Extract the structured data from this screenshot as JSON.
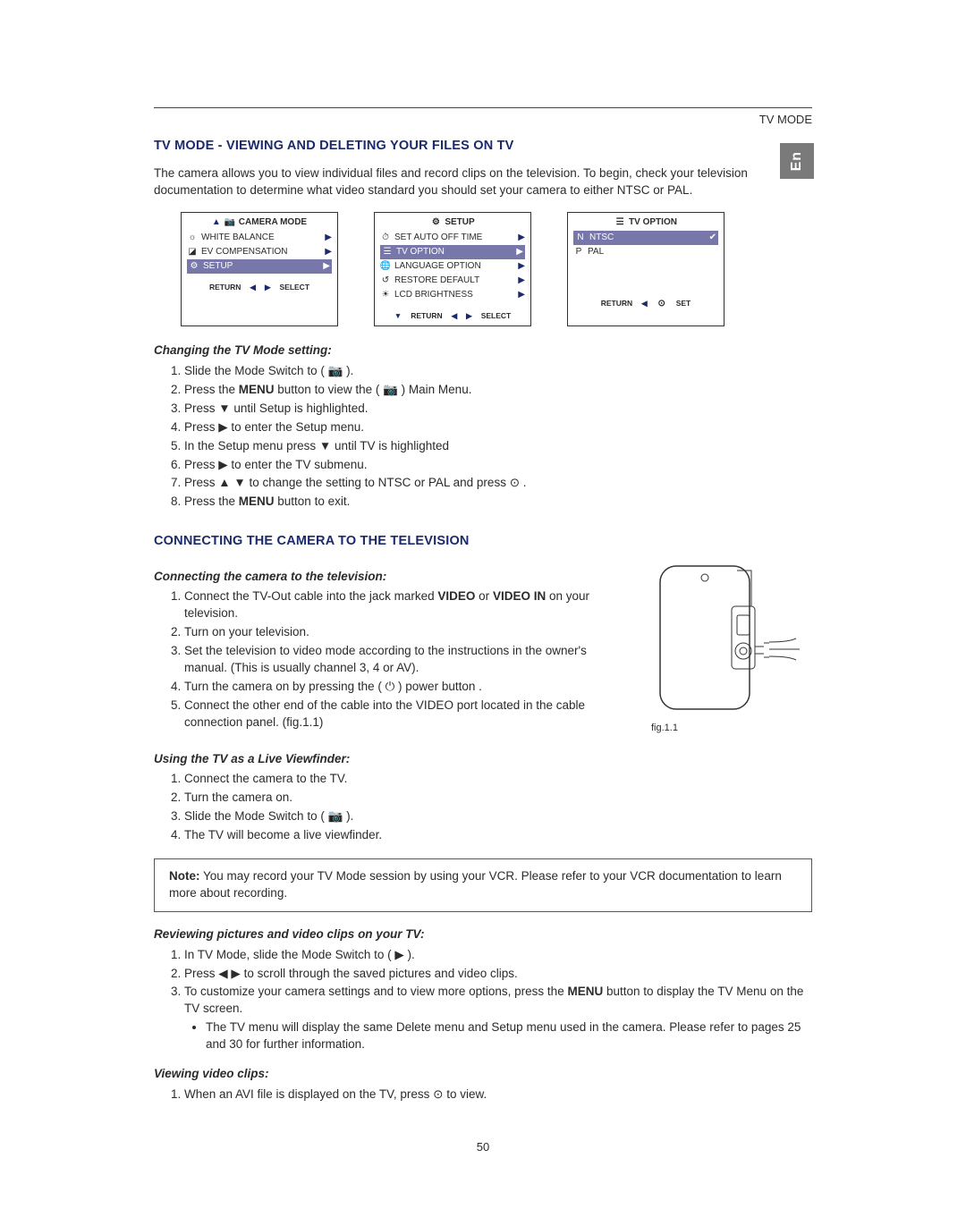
{
  "header": {
    "corner": "TV MODE",
    "lang_tab": "En"
  },
  "section1": {
    "title": "TV MODE - VIEWING AND DELETING YOUR FILES ON TV",
    "intro": "The camera allows you to view individual files and record clips on the television. To begin, check your television documentation to determine what video standard you should set your camera to either NTSC or PAL."
  },
  "screens": {
    "camera_mode": {
      "title": "CAMERA MODE",
      "items": [
        "WHITE BALANCE",
        "EV COMPENSATION",
        "SETUP"
      ],
      "selected_index": 2,
      "footer_left": "RETURN",
      "footer_right": "SELECT"
    },
    "setup": {
      "title": "SETUP",
      "items": [
        "SET AUTO OFF TIME",
        "TV OPTION",
        "LANGUAGE OPTION",
        "RESTORE DEFAULT",
        "LCD BRIGHTNESS"
      ],
      "selected_index": 1,
      "footer_left": "RETURN",
      "footer_right": "SELECT"
    },
    "tv_option": {
      "title": "TV  OPTION",
      "items": [
        "NTSC",
        "PAL"
      ],
      "selected_index": 0,
      "footer_left": "RETURN",
      "footer_right": "SET"
    }
  },
  "change_tv": {
    "heading": "Changing the TV Mode setting:",
    "steps": [
      "Slide the Mode Switch to ( 📷 ).",
      "Press the MENU button to view the ( 📷 ) Main Menu.",
      "Press ▼ until Setup is highlighted.",
      "Press ▶ to enter the Setup menu.",
      "In the Setup menu press ▼ until TV is highlighted",
      "Press ▶ to enter the TV submenu.",
      "Press ▲ ▼ to change the setting to NTSC or PAL and press ⊙ .",
      "Press the MENU button to exit."
    ]
  },
  "section2": {
    "title": "CONNECTING THE CAMERA TO THE TELEVISION"
  },
  "connect": {
    "heading": "Connecting the camera to the television:",
    "steps": [
      "Connect the TV-Out cable into the jack marked VIDEO or VIDEO IN on your television.",
      "Turn on your television.",
      "Set the television to video mode according to the instructions in the owner's manual. (This is usually channel 3, 4 or AV).",
      "Turn the camera on by pressing the ( ⏻ ) power button .",
      "Connect the other end of the cable into the VIDEO port located in the cable connection panel. (fig.1.1)"
    ],
    "fig_caption": "fig.1.1"
  },
  "live_viewfinder": {
    "heading": "Using the TV as a Live Viewfinder:",
    "steps": [
      "Connect the camera to the TV.",
      "Turn the camera on.",
      "Slide the Mode Switch to ( 📷 ).",
      "The TV will become a live viewfinder."
    ]
  },
  "note": {
    "label": "Note:",
    "text": " You may record your TV Mode session by using your VCR.  Please refer to your VCR documentation to learn more about recording."
  },
  "review": {
    "heading": "Reviewing pictures and video clips on your TV:",
    "steps": [
      "In TV Mode, slide the Mode Switch to ( ▶ ).",
      "Press ◀ ▶ to scroll through the saved pictures and video clips.",
      "To customize your camera settings and to view more options, press the MENU button to display the TV Menu on the TV screen."
    ],
    "bullet": "The TV menu will display the same Delete menu and Setup menu used in the camera. Please refer to pages 25 and 30 for further information."
  },
  "viewing": {
    "heading": "Viewing video clips:",
    "step": "When an AVI file is displayed on the TV, press ⊙ to view."
  },
  "page_number": "50"
}
